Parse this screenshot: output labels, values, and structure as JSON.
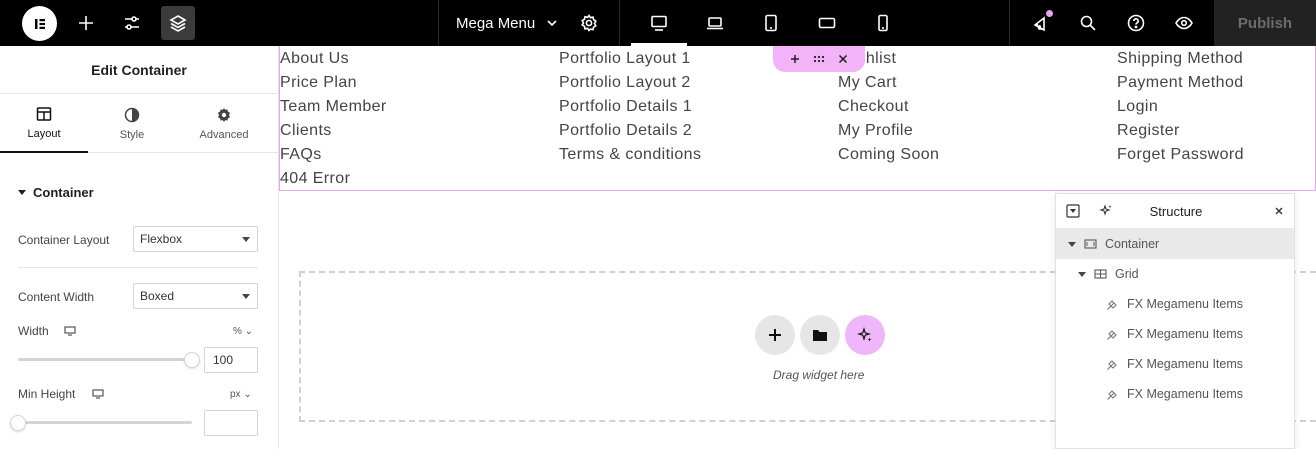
{
  "topbar": {
    "document_title": "Mega Menu",
    "publish_label": "Publish",
    "colors": {
      "background": "#000000",
      "accent": "#e7a4f3"
    }
  },
  "panel": {
    "title": "Edit Container",
    "tabs": [
      {
        "label": "Layout",
        "icon": "layout-icon",
        "active": true
      },
      {
        "label": "Style",
        "icon": "half-circle-icon",
        "active": false
      },
      {
        "label": "Advanced",
        "icon": "gear-icon",
        "active": false
      }
    ],
    "section_title": "Container",
    "container_layout": {
      "label": "Container Layout",
      "value": "Flexbox"
    },
    "content_width": {
      "label": "Content Width",
      "value": "Boxed"
    },
    "width": {
      "label": "Width",
      "unit": "%",
      "value": "100",
      "slider_fraction": 1.0
    },
    "min_height": {
      "label": "Min Height",
      "unit": "px",
      "value": "",
      "slider_fraction": 0.0
    }
  },
  "menu": {
    "columns": [
      [
        "About Us",
        "Price Plan",
        "Team Member",
        "Clients",
        "FAQs",
        "404 Error"
      ],
      [
        "Portfolio Layout 1",
        "Portfolio Layout 2",
        "Portfolio Details 1",
        "Portfolio Details 2",
        "Terms & conditions"
      ],
      [
        "Wishlist",
        "My Cart",
        "Checkout",
        "My Profile",
        "Coming Soon"
      ],
      [
        "Shipping Method",
        "Payment Method",
        "Login",
        "Register",
        "Forget Password"
      ]
    ]
  },
  "canvas": {
    "drop_text": "Drag widget here"
  },
  "structure": {
    "title": "Structure",
    "items": [
      {
        "label": "Container",
        "level": 0,
        "selected": true,
        "icon": "container-icon"
      },
      {
        "label": "Grid",
        "level": 1,
        "selected": false,
        "icon": "grid-icon"
      },
      {
        "label": "FX Megamenu Items",
        "level": 2,
        "selected": false,
        "icon": "widget-icon"
      },
      {
        "label": "FX Megamenu Items",
        "level": 2,
        "selected": false,
        "icon": "widget-icon"
      },
      {
        "label": "FX Megamenu Items",
        "level": 2,
        "selected": false,
        "icon": "widget-icon"
      },
      {
        "label": "FX Megamenu Items",
        "level": 2,
        "selected": false,
        "icon": "widget-icon"
      }
    ]
  }
}
